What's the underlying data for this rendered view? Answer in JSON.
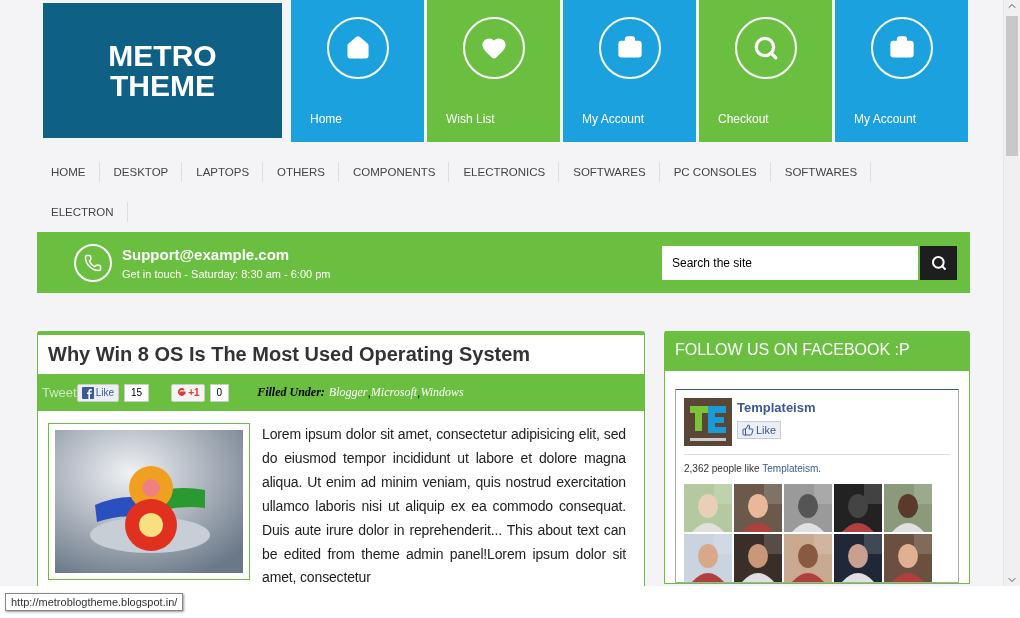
{
  "logo": {
    "lines": [
      "METRO",
      "THEME"
    ]
  },
  "tiles": [
    {
      "label": "Home",
      "color": "#1ba1de"
    },
    {
      "label": "Wish List",
      "color": "#6abf40"
    },
    {
      "label": "My Account",
      "color": "#1ba1de"
    },
    {
      "label": "Checkout",
      "color": "#6abf40"
    },
    {
      "label": "My Account",
      "color": "#1ba1de"
    }
  ],
  "nav": [
    "HOME",
    "DESKTOP",
    "LAPTOPS",
    "OTHERS",
    "COMPONENTS",
    "ELECTRONICS",
    "SOFTWARES",
    "PC CONSOLES",
    "SOFTWARES",
    "ELECTRON"
  ],
  "contact": {
    "email": "Support@example.com",
    "hours": "Get in touch - Saturday: 8:30 am - 6:00 pm"
  },
  "search": {
    "placeholder": "Search the site"
  },
  "post": {
    "title": "Why Win 8 OS Is The Most Used Operating System",
    "tweet": "Tweet",
    "like": "Like",
    "like_count": "15",
    "plus": "+1",
    "plus_count": "0",
    "filed_label": "Filled Under:",
    "categories": [
      "Blogger",
      "Microsoft",
      "Windows"
    ],
    "category_separator": ",",
    "body": "Lorem ipsum dolor sit amet, consectetur adipisicing elit, sed do eiusmod tempor incididunt ut labore et dolore magna aliqua. Ut enim ad minim veniam, quis nostrud exercitation ullamco laboris nisi ut aliquip ex ea commodo consequat. Duis aute irure dolor in reprehenderit... This about text can be edited from theme admin panel!Lorem ipsum dolor sit amet, consectetur"
  },
  "facebook": {
    "heading": "FOLLOW US ON FACEBOOK :P",
    "page_name": "Templateism",
    "like": "Like",
    "count_text": "2,362 people like",
    "count_link": "Templateism."
  },
  "status_url": "http://metroblogtheme.blogspot.in/"
}
